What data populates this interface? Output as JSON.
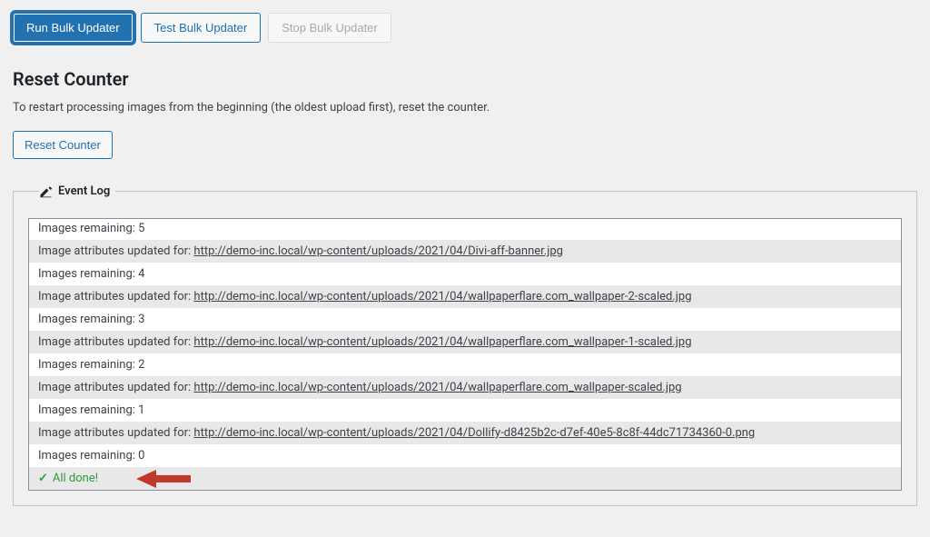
{
  "buttons": {
    "run": "Run Bulk Updater",
    "test": "Test Bulk Updater",
    "stop": "Stop Bulk Updater"
  },
  "reset": {
    "heading": "Reset Counter",
    "desc": "To restart processing images from the beginning (the oldest upload first), reset the counter.",
    "button": "Reset Counter"
  },
  "eventLog": {
    "title": "Event Log",
    "updatedPrefix": "Image attributes updated for: ",
    "remainingPrefix": "Images remaining: ",
    "done": "All done!",
    "rows": [
      {
        "type": "remaining",
        "count": "5"
      },
      {
        "type": "updated",
        "url": "http://demo-inc.local/wp-content/uploads/2021/04/Divi-aff-banner.jpg"
      },
      {
        "type": "remaining",
        "count": "4"
      },
      {
        "type": "updated",
        "url": "http://demo-inc.local/wp-content/uploads/2021/04/wallpaperflare.com_wallpaper-2-scaled.jpg"
      },
      {
        "type": "remaining",
        "count": "3"
      },
      {
        "type": "updated",
        "url": "http://demo-inc.local/wp-content/uploads/2021/04/wallpaperflare.com_wallpaper-1-scaled.jpg"
      },
      {
        "type": "remaining",
        "count": "2"
      },
      {
        "type": "updated",
        "url": "http://demo-inc.local/wp-content/uploads/2021/04/wallpaperflare.com_wallpaper-scaled.jpg"
      },
      {
        "type": "remaining",
        "count": "1"
      },
      {
        "type": "updated",
        "url": "http://demo-inc.local/wp-content/uploads/2021/04/Dollify-d8425b2c-d7ef-40e5-8c8f-44dc71734360-0.png"
      },
      {
        "type": "remaining",
        "count": "0"
      },
      {
        "type": "done"
      }
    ]
  }
}
